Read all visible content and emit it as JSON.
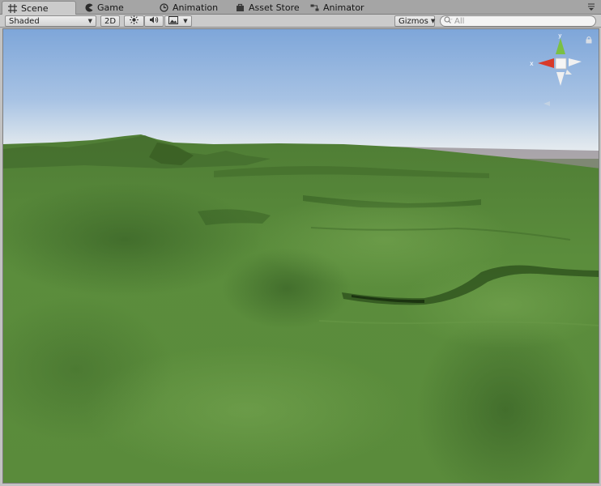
{
  "tabs": [
    {
      "label": "Scene",
      "icon": "scene-grid-icon",
      "active": true
    },
    {
      "label": "Game",
      "icon": "game-pacman-icon",
      "active": false
    },
    {
      "label": "Animation",
      "icon": "animation-clock-icon",
      "active": false
    },
    {
      "label": "Asset Store",
      "icon": "asset-store-bag-icon",
      "active": false
    },
    {
      "label": "Animator",
      "icon": "animator-icon",
      "active": false
    }
  ],
  "toolbar": {
    "shading_mode": "Shaded",
    "mode_2d": "2D",
    "lighting_icon": "sun-icon",
    "audio_icon": "speaker-icon",
    "effects_icon": "image-effects-icon",
    "gizmos_label": "Gizmos",
    "search_placeholder": "All",
    "search_prefix": "Q"
  },
  "gizmo": {
    "y_label": "y",
    "x_label": "x",
    "colors": {
      "x": "#d83a2a",
      "y": "#7bc043",
      "z": "#4b7bd6"
    }
  },
  "scene": {
    "sky_top": "#7ea6d9",
    "sky_horizon": "#e8eef2",
    "terrain": "#5b8c3c"
  }
}
